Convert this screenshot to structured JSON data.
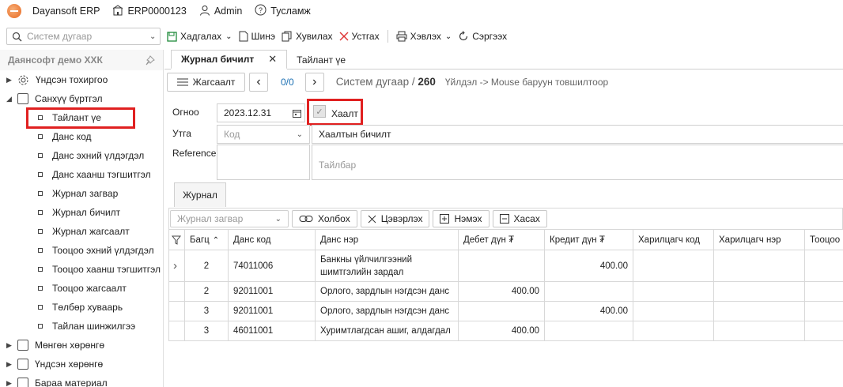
{
  "topbar": {
    "app": "Dayansoft ERP",
    "company": "ERP0000123",
    "user": "Admin",
    "help": "Тусламж"
  },
  "search": {
    "placeholder": "Систем дугаар"
  },
  "toolbar": {
    "save": "Хадгалах",
    "new": "Шинэ",
    "copy": "Хувилах",
    "delete": "Устгах",
    "print": "Хэвлэх",
    "refresh": "Сэргээх"
  },
  "sidebar": {
    "title": "Даянсофт демо ХХК",
    "nodes": [
      {
        "label": "Үндсэн тохиргоо",
        "expanded": false
      },
      {
        "label": "Санхүү бүртгэл",
        "expanded": true
      }
    ],
    "leaves": [
      "Тайлант үе",
      "Данс код",
      "Данс эхний үлдэгдэл",
      "Данс хаанш тэгшитгэл",
      "Журнал загвар",
      "Журнал бичилт",
      "Журнал жагсаалт",
      "Тооцоо эхний үлдэгдэл",
      "Тооцоо хаанш тэгшитгэл",
      "Тооцоо жагсаалт",
      "Төлбөр хуваарь",
      "Тайлан шинжилгээ"
    ],
    "bottom_nodes": [
      "Мөнгөн хөрөнгө",
      "Үндсэн хөрөнгө",
      "Бараа материал"
    ]
  },
  "tabs": [
    "Журнал бичилт",
    "Тайлант үе"
  ],
  "nav": {
    "list": "Жагсаалт",
    "counter": "0/0",
    "breadcrumb": "Систем дугаар / ",
    "docnum": "260",
    "hint": "Үйлдэл -> Mouse баруун товшилтоор"
  },
  "form": {
    "date_label": "Огноо",
    "date": "2023.12.31",
    "closing_label": "Хаалт",
    "utga_label": "Утга",
    "code_ph": "Код",
    "utga_value": "Хаалтын бичилт",
    "ref_label": "Reference",
    "desc_ph": "Тайлбар"
  },
  "subtab": "Журнал",
  "gridbar": {
    "template_ph": "Журнал загвар",
    "link": "Холбох",
    "clear": "Цэвэрлэх",
    "add": "Нэмэх",
    "remove": "Хасах"
  },
  "grid": {
    "headers": [
      "Багц",
      "Данс код",
      "Данс нэр",
      "Дебет дүн ₮",
      "Кредит дүн ₮",
      "Харилцагч код",
      "Харилцагч нэр",
      "Тооцоо"
    ],
    "rows": [
      {
        "batch": "2",
        "code": "74011006",
        "name": "Банкны үйлчилгээний шимтгэлийн зардал",
        "debit": "",
        "credit": "400.00"
      },
      {
        "batch": "2",
        "code": "92011001",
        "name": "Орлого, зардлын нэгдсэн данс",
        "debit": "400.00",
        "credit": ""
      },
      {
        "batch": "3",
        "code": "92011001",
        "name": "Орлого, зардлын нэгдсэн данс",
        "debit": "",
        "credit": "400.00"
      },
      {
        "batch": "3",
        "code": "46011001",
        "name": "Хуримтлагдсан ашиг, алдагдал",
        "debit": "400.00",
        "credit": ""
      }
    ]
  },
  "colors": {
    "highlight": "#e02020",
    "accent": "#1a6fb3",
    "logo": "#e8671e"
  }
}
